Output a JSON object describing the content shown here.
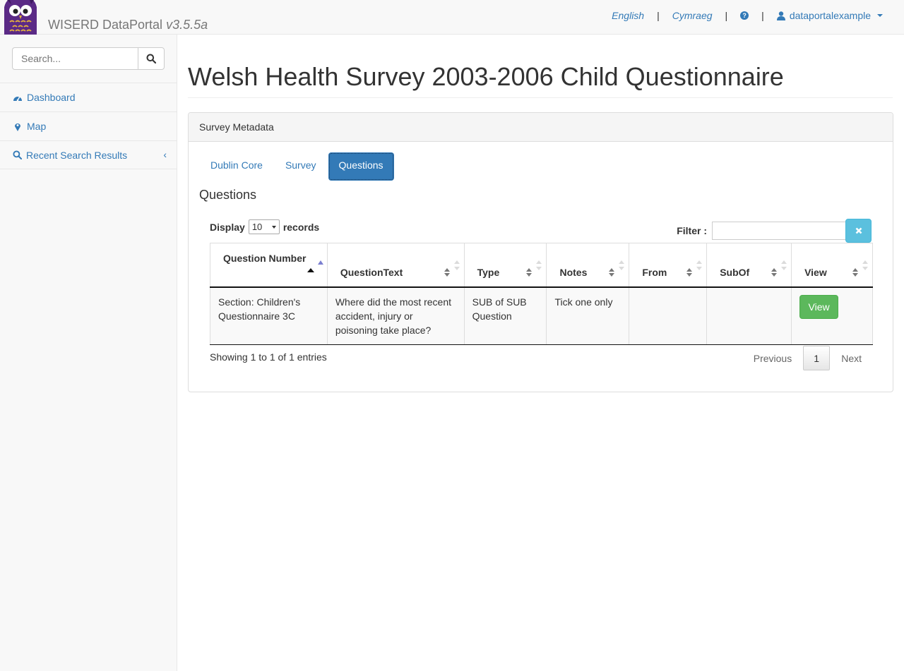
{
  "navbar": {
    "brand": "WISERD DataPortal",
    "version": "v3.5.5a",
    "lang_english": "English",
    "lang_welsh": "Cymraeg",
    "separator": "|",
    "help_icon": "question-circle-icon",
    "username": "dataportalexample"
  },
  "sidebar": {
    "search_placeholder": "Search...",
    "items": [
      {
        "label": "Dashboard",
        "icon": "dashboard-icon"
      },
      {
        "label": "Map",
        "icon": "map-marker-icon"
      },
      {
        "label": "Recent Search Results",
        "icon": "search-icon",
        "chevron": "‹"
      }
    ]
  },
  "page": {
    "title": "Welsh Health Survey 2003-2006 Child Questionnaire"
  },
  "panel": {
    "heading": "Survey Metadata",
    "tabs": [
      "Dublin Core",
      "Survey",
      "Questions"
    ],
    "active_tab": "Questions",
    "section_title": "Questions"
  },
  "table_controls": {
    "display_label": "Display",
    "page_length": "10",
    "records_label": "records",
    "filter_label": "Filter :",
    "filter_value": "",
    "clear_icon": "times-icon"
  },
  "table": {
    "columns": [
      "Question Number",
      "QuestionText",
      "Type",
      "Notes",
      "From",
      "SubOf",
      "View"
    ],
    "rows": [
      {
        "question_number": "Section: Children's Questionnaire 3C",
        "question_text": "Where did the most recent accident, injury or poisoning take place?",
        "type": "SUB of SUB Question",
        "notes": "Tick one only",
        "from": "",
        "sub_of": "",
        "view_label": "View"
      }
    ]
  },
  "footer": {
    "info": "Showing 1 to 1 of 1 entries",
    "previous": "Previous",
    "current_page": "1",
    "next": "Next"
  },
  "colors": {
    "link": "#337ab7",
    "primary": "#337ab7",
    "success": "#5cb85c",
    "info": "#5bc0de",
    "logo_purple": "#5b2a86"
  }
}
